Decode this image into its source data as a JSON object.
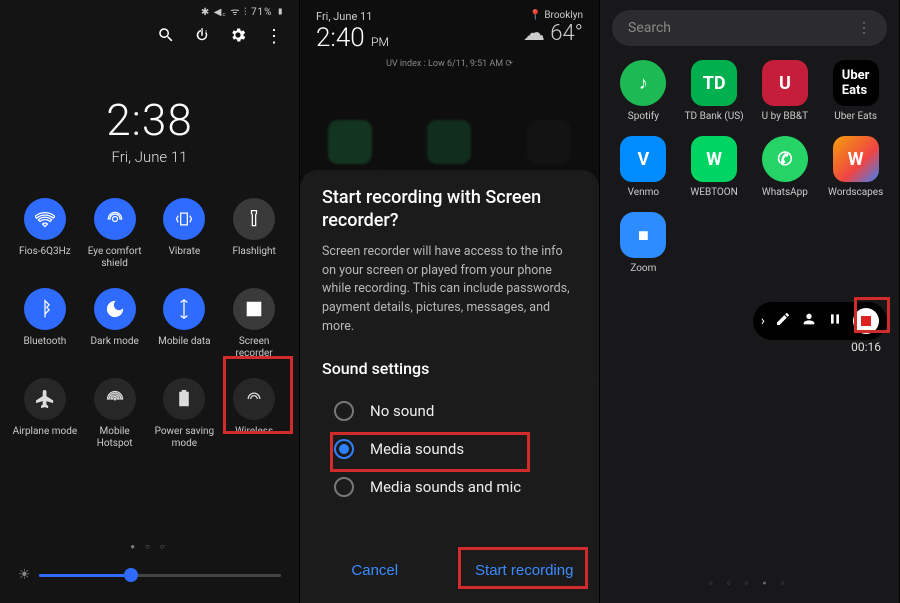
{
  "panel1": {
    "status": "✱ ◀꜀ ᯤ ⫶ 71% ▮",
    "time": "2:38",
    "date": "Fri, June 11",
    "tiles": [
      {
        "label": "Fios-6Q3Hz",
        "on": true,
        "icon": "wifi"
      },
      {
        "label": "Eye comfort shield",
        "on": true,
        "icon": "eye"
      },
      {
        "label": "Vibrate",
        "on": true,
        "icon": "vibrate"
      },
      {
        "label": "Flashlight",
        "on": false,
        "icon": "flashlight"
      },
      {
        "label": "Bluetooth",
        "on": true,
        "icon": "bluetooth"
      },
      {
        "label": "Dark mode",
        "on": true,
        "icon": "moon"
      },
      {
        "label": "Mobile data",
        "on": true,
        "icon": "data"
      },
      {
        "label": "Screen recorder",
        "on": false,
        "icon": "record"
      },
      {
        "label": "Airplane mode",
        "on": false,
        "icon": "plane"
      },
      {
        "label": "Mobile Hotspot",
        "on": false,
        "icon": "hotspot"
      },
      {
        "label": "Power saving mode",
        "on": false,
        "icon": "battery"
      },
      {
        "label": "Wireless",
        "on": false,
        "icon": "wireless"
      }
    ]
  },
  "panel2": {
    "date": "Fri, June 11",
    "time": "2:40",
    "meridiem": "PM",
    "location": "Brooklyn",
    "temp": "64°",
    "uv": "UV index : Low   6/11, 9:51 AM ⟳",
    "dialog_title": "Start recording with Screen recorder?",
    "dialog_desc": "Screen recorder will have access to the info on your screen or played from your phone while recording. This can include passwords, payment details, pictures, messages, and more.",
    "section": "Sound settings",
    "opt_none": "No sound",
    "opt_media": "Media sounds",
    "opt_mic": "Media sounds and mic",
    "btn_cancel": "Cancel",
    "btn_start": "Start recording"
  },
  "panel3": {
    "search_placeholder": "Search",
    "apps": [
      {
        "label": "Spotify",
        "class": "ic-spotify",
        "glyph": "♪"
      },
      {
        "label": "TD Bank (US)",
        "class": "ic-td",
        "glyph": "TD"
      },
      {
        "label": "U by BB&T",
        "class": "ic-u",
        "glyph": "U"
      },
      {
        "label": "Uber Eats",
        "class": "ic-uber",
        "glyph": "Uber\nEats"
      },
      {
        "label": "Venmo",
        "class": "ic-venmo",
        "glyph": "V"
      },
      {
        "label": "WEBTOON",
        "class": "ic-webtoon",
        "glyph": "W"
      },
      {
        "label": "WhatsApp",
        "class": "ic-whatsapp",
        "glyph": "✆"
      },
      {
        "label": "Wordscapes",
        "class": "ic-wordscapes",
        "glyph": "W"
      },
      {
        "label": "Zoom",
        "class": "ic-zoom",
        "glyph": "■"
      }
    ],
    "rec_time": "00:16"
  }
}
